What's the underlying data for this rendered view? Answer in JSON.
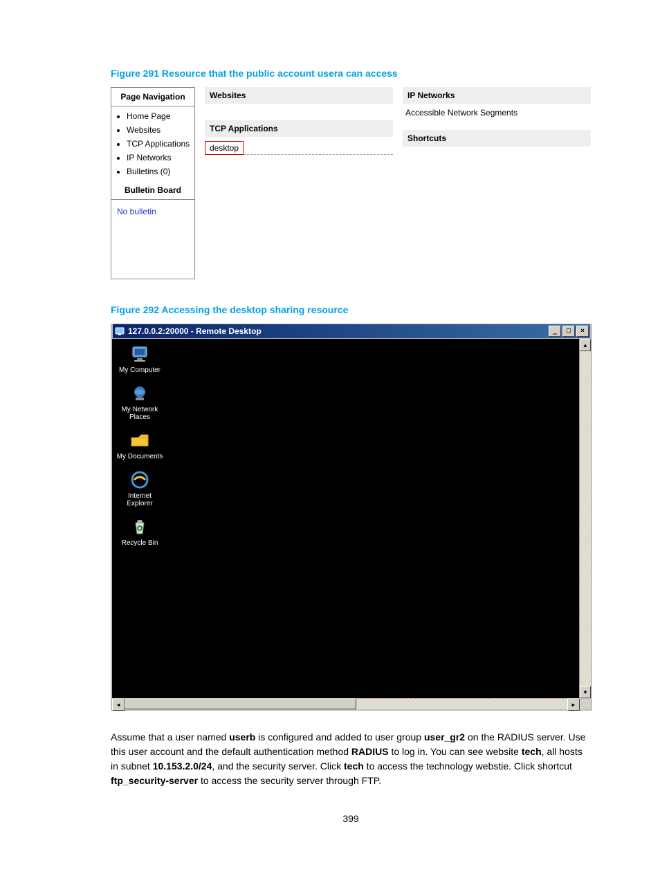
{
  "figure291": {
    "caption": "Figure 291 Resource that the public account usera can access",
    "sidebar": {
      "header": "Page Navigation",
      "items": [
        "Home Page",
        "Websites",
        "TCP Applications",
        "IP Networks",
        "Bulletins (0)"
      ],
      "bulletin_header": "Bulletin Board",
      "no_bulletin": "No bulletin"
    },
    "middle": {
      "websites": "Websites",
      "tcp": "TCP Applications",
      "desktop": "desktop"
    },
    "right": {
      "ipnet": "IP Networks",
      "acc_seg": "Accessible Network Segments",
      "shortcuts": "Shortcuts"
    }
  },
  "figure292": {
    "caption": "Figure 292 Accessing the desktop sharing resource",
    "title": "127.0.0.2:20000 - Remote Desktop",
    "icons": [
      "My Computer",
      "My Network Places",
      "My Documents",
      "Internet Explorer",
      "Recycle Bin"
    ]
  },
  "para": {
    "t1": "Assume that a user named ",
    "b1": "userb",
    "t2": " is configured and added to user group ",
    "b2": "user_gr2",
    "t3": " on the RADIUS server. Use this user account and the default authentication method ",
    "b3": "RADIUS",
    "t4": " to log in. You can see website ",
    "b4": "tech",
    "t5": ", all hosts in subnet ",
    "b5": "10.153.2.0/24",
    "t6": ", and the security server. Click ",
    "b6": "tech",
    "t7": " to access the technology webstie. Click shortcut ",
    "b7": "ftp_security-server",
    "t8": " to access the security server through FTP."
  },
  "pagenum": "399"
}
